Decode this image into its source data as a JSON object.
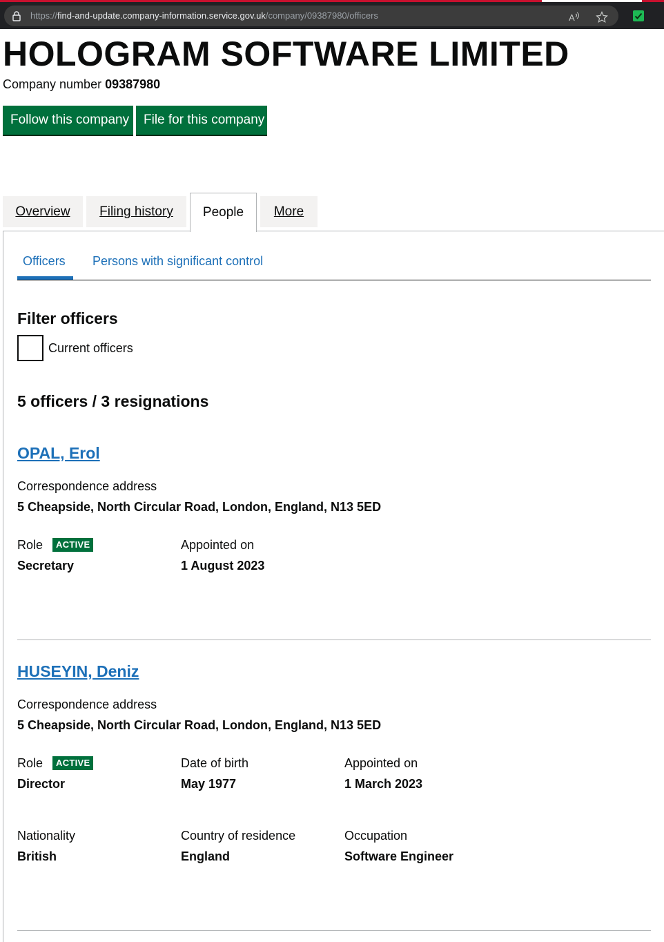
{
  "browser": {
    "url_scheme": "https://",
    "url_host": "find-and-update.company-information.service.gov.uk",
    "url_path": "/company/09387980/officers",
    "icons": [
      "lock-icon",
      "read-aloud-icon",
      "favorite-star-icon",
      "extension-check-icon"
    ]
  },
  "company": {
    "name": "HOLOGRAM SOFTWARE LIMITED",
    "number_label": "Company number",
    "number": "09387980"
  },
  "actions": {
    "follow": "Follow this company",
    "file": "File for this company"
  },
  "tabs": [
    {
      "label": "Overview"
    },
    {
      "label": "Filing history"
    },
    {
      "label": "People"
    },
    {
      "label": "More"
    }
  ],
  "subtabs": [
    {
      "label": "Officers"
    },
    {
      "label": "Persons with significant control"
    }
  ],
  "filter": {
    "heading": "Filter officers",
    "checkbox_label": "Current officers"
  },
  "summary": "5 officers / 3 resignations",
  "officers": [
    {
      "name": "OPAL, Erol",
      "address_label": "Correspondence address",
      "address": "5 Cheapside, North Circular Road, London, England, N13 5ED",
      "role_label": "Role",
      "status": "ACTIVE",
      "role": "Secretary",
      "appointed_label": "Appointed on",
      "appointed": "1 August 2023"
    },
    {
      "name": "HUSEYIN, Deniz",
      "address_label": "Correspondence address",
      "address": "5 Cheapside, North Circular Road, London, England, N13 5ED",
      "role_label": "Role",
      "status": "ACTIVE",
      "role": "Director",
      "dob_label": "Date of birth",
      "dob": "May 1977",
      "appointed_label": "Appointed on",
      "appointed": "1 March 2023",
      "nationality_label": "Nationality",
      "nationality": "British",
      "residence_label": "Country of residence",
      "residence": "England",
      "occupation_label": "Occupation",
      "occupation": "Software Engineer"
    }
  ],
  "colors": {
    "button_green": "#00703c",
    "link_blue": "#1d70b8",
    "text": "#0b0c0c"
  }
}
